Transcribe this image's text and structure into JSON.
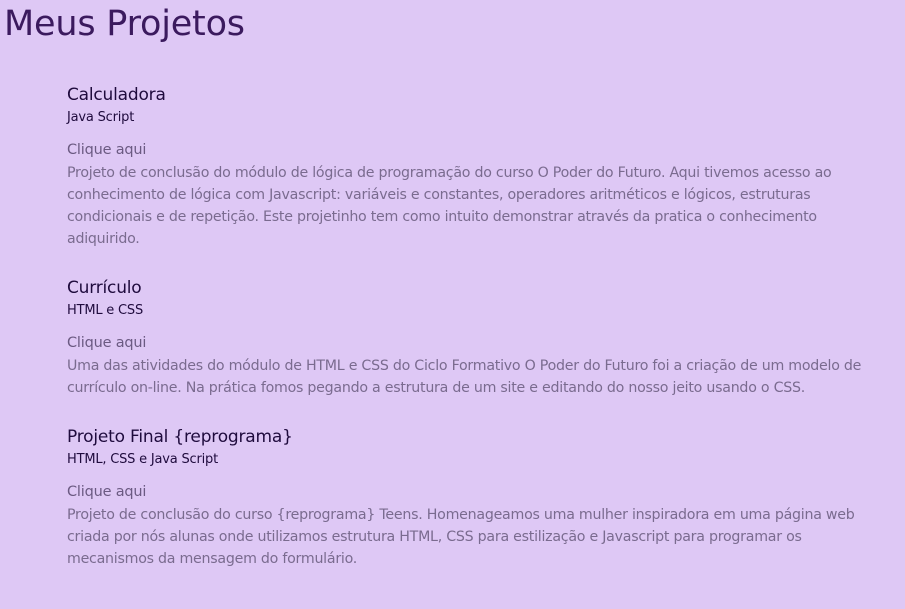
{
  "header": {
    "title": "Meus Projetos"
  },
  "projects": [
    {
      "title": "Calculadora",
      "tech": "Java Script",
      "link": "Clique aqui",
      "description": "Projeto de conclusão do módulo de lógica de programação do curso O Poder do Futuro. Aqui tivemos acesso ao conhecimento de lógica com Javascript: variáveis e constantes, operadores aritméticos e lógicos, estruturas condicionais e de repetição. Este projetinho tem como intuito demonstrar através da pratica o conhecimento adiquirido."
    },
    {
      "title": "Currículo",
      "tech": "HTML e CSS",
      "link": "Clique aqui",
      "description": "Uma das atividades do módulo de HTML e CSS do Ciclo Formativo O Poder do Futuro foi a criação de um modelo de currículo on-line. Na prática fomos pegando a estrutura de um site e editando do nosso jeito usando o CSS."
    },
    {
      "title": "Projeto Final {reprograma}",
      "tech": "HTML, CSS e Java Script",
      "link": "Clique aqui",
      "description": "Projeto de conclusão do curso {reprograma} Teens. Homenageamos uma mulher inspiradora em uma página web criada por nós alunas onde utilizamos estrutura HTML, CSS para estilização e Javascript para programar os mecanismos da mensagem do formulário."
    }
  ]
}
